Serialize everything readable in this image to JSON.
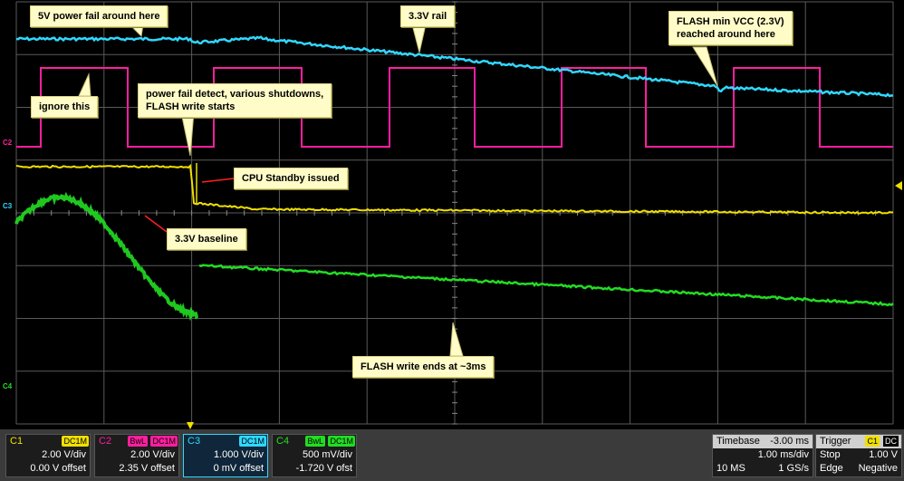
{
  "channels": {
    "C1": {
      "name": "C1",
      "coupling": "DC1M",
      "vdiv": "2.00 V/div",
      "offset": "0.00 V offset",
      "color": "#f0e000"
    },
    "C2": {
      "name": "C2",
      "bwl": "BwL",
      "coupling": "DC1M",
      "vdiv": "2.00 V/div",
      "offset": "2.35 V offset",
      "color": "#ff1ea0"
    },
    "C3": {
      "name": "C3",
      "coupling": "DC1M",
      "vdiv": "1.000 V/div",
      "offset": "0 mV offset",
      "color": "#30d8ff"
    },
    "C4": {
      "name": "C4",
      "bwl": "BwL",
      "coupling": "DC1M",
      "vdiv": "500 mV/div",
      "offset": "-1.720 V ofst",
      "color": "#22dd22"
    }
  },
  "timebase": {
    "label": "Timebase",
    "delay": "-3.00 ms",
    "tdiv": "1.00 ms/div",
    "samples": "10 MS",
    "rate": "1 GS/s"
  },
  "trigger": {
    "label": "Trigger",
    "source": "C1",
    "coupling": "DC",
    "mode": "Stop",
    "level": "1.00 V",
    "type": "Edge",
    "slope": "Negative"
  },
  "trace_labels": {
    "c2": "C2",
    "c3": "C3",
    "c4": "C4"
  },
  "annotations": {
    "a_5v": "5V power fail around here",
    "a_33": "3.3V rail",
    "a_flash_min": "FLASH min VCC (2.3V)\nreached around here",
    "a_ignore": "ignore this",
    "a_pf": "power fail detect, various shutdowns,\nFLASH write starts",
    "a_cpu": "CPU Standby issued",
    "a_base": "3.3V baseline",
    "a_flash_end": "FLASH write ends at ~3ms"
  },
  "colors": {
    "grid": "#5a5a5a",
    "callout_bg": "#fffcc8",
    "arrow": "#ff2020"
  }
}
